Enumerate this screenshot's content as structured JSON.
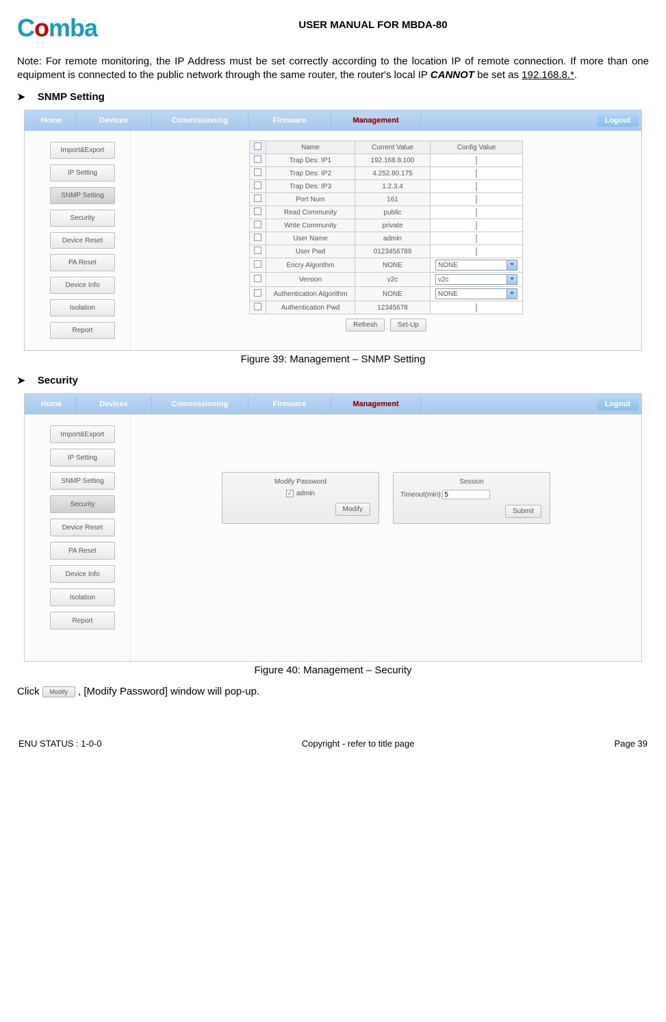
{
  "header": {
    "logo_text": "Comba",
    "doc_title": "USER MANUAL FOR MBDA-80"
  },
  "note": {
    "prefix": "Note: For remote monitoring, the IP Address must be set correctly according to the location IP of remote connection. If more than one equipment is connected to the public network through the same router, the router's local IP ",
    "cannot": "CANNOT",
    "mid": " be set as ",
    "ip": "192.168.8.*",
    "suffix": "."
  },
  "sections": {
    "snmp_title": "SNMP Setting",
    "security_title": "Security"
  },
  "nav": {
    "home": "Home",
    "devices": "Devices",
    "commissioning": "Commissioning",
    "firmware": "Firmware",
    "management": "Management",
    "logout": "Logout"
  },
  "sidebar": {
    "items": [
      "Import&Export",
      "IP Setting",
      "SNMP Setting",
      "Security",
      "Device Reset",
      "PA Reset",
      "Device Info",
      "Isolation",
      "Report"
    ]
  },
  "snmp_table": {
    "headers": {
      "name": "Name",
      "current": "Current Value",
      "config": "Config Value"
    },
    "rows": [
      {
        "name": "Trap Des: IP1",
        "current": "192.168.8.100",
        "type": "text"
      },
      {
        "name": "Trap Des: IP2",
        "current": "4.252.80.175",
        "type": "text"
      },
      {
        "name": "Trap Des: IP3",
        "current": "1.2.3.4",
        "type": "text"
      },
      {
        "name": "Port Num",
        "current": "161",
        "type": "text"
      },
      {
        "name": "Read Community",
        "current": "public",
        "type": "text"
      },
      {
        "name": "Write Community",
        "current": "private",
        "type": "text"
      },
      {
        "name": "User Name",
        "current": "admin",
        "type": "text"
      },
      {
        "name": "User Pwd",
        "current": "0123456789",
        "type": "text"
      },
      {
        "name": "Encry Algorithm",
        "current": "NONE",
        "type": "select",
        "selected": "NONE"
      },
      {
        "name": "Version",
        "current": "v2c",
        "type": "select",
        "selected": "v2c"
      },
      {
        "name": "Authentication Algorithm",
        "current": "NONE",
        "type": "select",
        "selected": "NONE"
      },
      {
        "name": "Authentication Pwd",
        "current": "12345678",
        "type": "text"
      }
    ],
    "buttons": {
      "refresh": "Refresh",
      "setup": "Set-Up"
    }
  },
  "captions": {
    "fig39": "Figure 39: Management – SNMP Setting",
    "fig40": "Figure 40: Management – Security"
  },
  "security_panels": {
    "modify": {
      "title": "Modify Password",
      "user": "admin",
      "button": "Modify"
    },
    "session": {
      "title": "Session",
      "label": "Timeout(min):",
      "value": "5",
      "button": "Submit"
    }
  },
  "click_line": {
    "pre": "Click ",
    "btn": "Modify",
    "post": ", [Modify Password] window will pop-up."
  },
  "footer": {
    "left": "ENU STATUS : 1-0-0",
    "mid": "Copyright - refer to title page",
    "right": "Page 39"
  }
}
